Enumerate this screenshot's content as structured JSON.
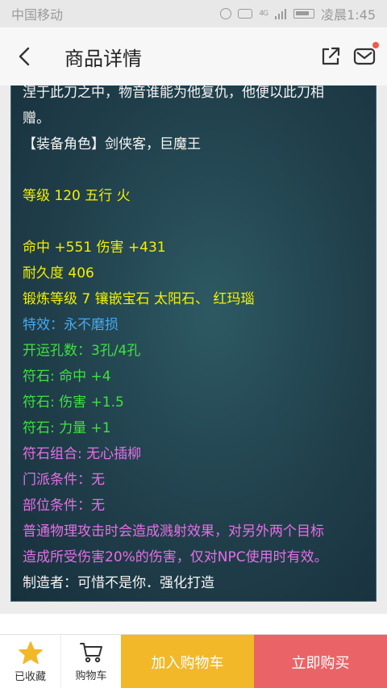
{
  "status_bar": {
    "carrier": "中国移动",
    "network": "4G",
    "time": "凌晨1:45"
  },
  "nav": {
    "title": "商品详情",
    "icons": [
      "chevron-left-icon",
      "share-icon",
      "mail-icon"
    ],
    "accent_dot_color": "#f05a4a"
  },
  "item": {
    "lines": [
      {
        "text": "涅于此刀之中，物音谁能为他复仇，他便以此刀相",
        "color": "white"
      },
      {
        "text": "赠。",
        "color": "white"
      },
      {
        "text": "【装备角色】剑侠客，巨魔王",
        "color": "white"
      },
      {
        "text": "等级 120 五行 火",
        "color": "yellow"
      },
      {
        "text": "命中 +551 伤害 +431",
        "color": "yellow"
      },
      {
        "text": "耐久度 406",
        "color": "yellow"
      },
      {
        "text": "锻炼等级 7 镶嵌宝石 太阳石、 红玛瑙",
        "color": "yellow"
      },
      {
        "text": "特效：永不磨损",
        "color": "blue"
      },
      {
        "text": "开运孔数：3孔/4孔",
        "color": "green"
      },
      {
        "text": "符石: 命中 +4",
        "color": "green"
      },
      {
        "text": "符石: 伤害 +1.5",
        "color": "green"
      },
      {
        "text": "符石: 力量 +1",
        "color": "green"
      },
      {
        "text": "符石组合: 无心插柳",
        "color": "pink"
      },
      {
        "text": "门派条件：无",
        "color": "pink"
      },
      {
        "text": "部位条件：无",
        "color": "pink"
      },
      {
        "text": "普通物理攻击时会造成溅射效果，对另外两个目标",
        "color": "pink"
      },
      {
        "text": "造成所受伤害20%的伤害，仅对NPC使用时有效。",
        "color": "pink"
      },
      {
        "text": "制造者：可惜不是你．强化打造",
        "color": "white"
      }
    ]
  },
  "bottom_bar": {
    "favorite_label": "已收藏",
    "cart_label": "购物车",
    "add_to_cart_label": "加入购物车",
    "buy_now_label": "立即购买",
    "add_to_cart_color": "#f2b82a",
    "buy_now_color": "#ea6467",
    "favorite_star_color": "#f2b82a"
  }
}
